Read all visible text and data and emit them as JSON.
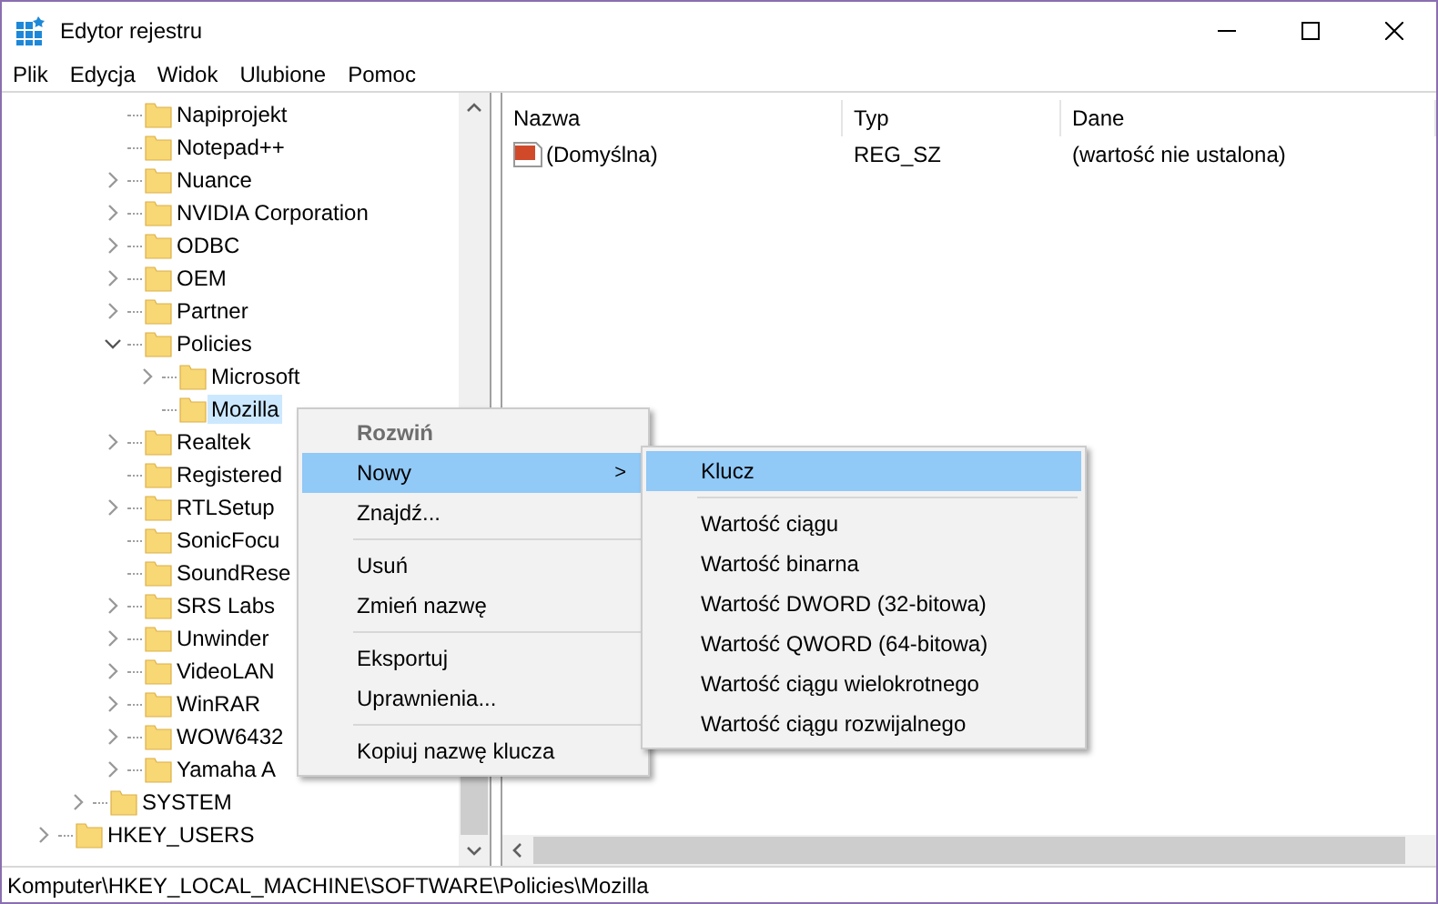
{
  "window": {
    "title": "Edytor rejestru"
  },
  "menu_bar": [
    "Plik",
    "Edycja",
    "Widok",
    "Ulubione",
    "Pomoc"
  ],
  "tree": [
    {
      "children": [
        {
          "children": [
            {
              "label": "Napiprojekt",
              "selected": false
            },
            {
              "label": "Notepad++",
              "selected": false
            },
            {
              "label": "Nuance",
              "expanded": false,
              "selected": false
            },
            {
              "label": "NVIDIA Corporation",
              "expanded": false,
              "selected": false
            },
            {
              "label": "ODBC",
              "expanded": false,
              "selected": false
            },
            {
              "label": "OEM",
              "expanded": false,
              "selected": false
            },
            {
              "label": "Partner",
              "expanded": false,
              "selected": false
            },
            {
              "label": "Policies",
              "expanded": true,
              "selected": false,
              "children": [
                {
                  "label": "Microsoft",
                  "expanded": false,
                  "selected": false
                },
                {
                  "label": "Mozilla",
                  "selected": true
                }
              ]
            },
            {
              "label": "Realtek",
              "expanded": false,
              "selected": false
            },
            {
              "label": "Registered",
              "selected": false
            },
            {
              "label": "RTLSetup",
              "expanded": false,
              "selected": false
            },
            {
              "label": "SonicFocu",
              "selected": false
            },
            {
              "label": "SoundRese",
              "selected": false
            },
            {
              "label": "SRS Labs",
              "expanded": false,
              "selected": false
            },
            {
              "label": "Unwinder",
              "expanded": false,
              "selected": false
            },
            {
              "label": "VideoLAN",
              "expanded": false,
              "selected": false
            },
            {
              "label": "WinRAR",
              "expanded": false,
              "selected": false
            },
            {
              "label": "WOW6432",
              "expanded": false,
              "selected": false
            },
            {
              "label": "Yamaha A",
              "expanded": false,
              "selected": false
            }
          ]
        },
        {
          "label": "SYSTEM",
          "expanded": false,
          "selected": false
        }
      ]
    },
    {
      "label": "HKEY_USERS",
      "expanded": false,
      "selected": false
    }
  ],
  "values_table": {
    "columns": [
      "Nazwa",
      "Typ",
      "Dane"
    ],
    "rows": [
      {
        "name": "(Domyślna)",
        "type": "REG_SZ",
        "data": "(wartość nie ustalona)"
      }
    ]
  },
  "context_menu": {
    "items": [
      {
        "kind": "default",
        "label": "Rozwiń",
        "disabled": true,
        "selected": false
      },
      {
        "kind": "submenu",
        "label": "Nowy",
        "arrow": ">",
        "disabled": false,
        "selected": true
      },
      {
        "kind": "item",
        "label": "Znajdź...",
        "disabled": false,
        "selected": false
      },
      {
        "kind": "separator"
      },
      {
        "kind": "item",
        "label": "Usuń",
        "disabled": false,
        "selected": false
      },
      {
        "kind": "item",
        "label": "Zmień nazwę",
        "disabled": false,
        "selected": false
      },
      {
        "kind": "separator"
      },
      {
        "kind": "item",
        "label": "Eksportuj",
        "disabled": false,
        "selected": false
      },
      {
        "kind": "item",
        "label": "Uprawnienia...",
        "disabled": false,
        "selected": false
      },
      {
        "kind": "separator"
      },
      {
        "kind": "item",
        "label": "Kopiuj nazwę klucza",
        "disabled": false,
        "selected": false
      }
    ]
  },
  "submenu": {
    "items": [
      {
        "kind": "item",
        "label": "Klucz",
        "selected": true
      },
      {
        "kind": "separator"
      },
      {
        "kind": "item",
        "label": "Wartość ciągu",
        "selected": false
      },
      {
        "kind": "item",
        "label": "Wartość binarna",
        "selected": false
      },
      {
        "kind": "item",
        "label": "Wartość DWORD (32-bitowa)",
        "selected": false
      },
      {
        "kind": "item",
        "label": "Wartość QWORD (64-bitowa)",
        "selected": false
      },
      {
        "kind": "item",
        "label": "Wartość ciągu wielokrotnego",
        "selected": false
      },
      {
        "kind": "item",
        "label": "Wartość ciągu rozwijalnego",
        "selected": false
      }
    ]
  },
  "status_bar": "Komputer\\HKEY_LOCAL_MACHINE\\SOFTWARE\\Policies\\Mozilla"
}
